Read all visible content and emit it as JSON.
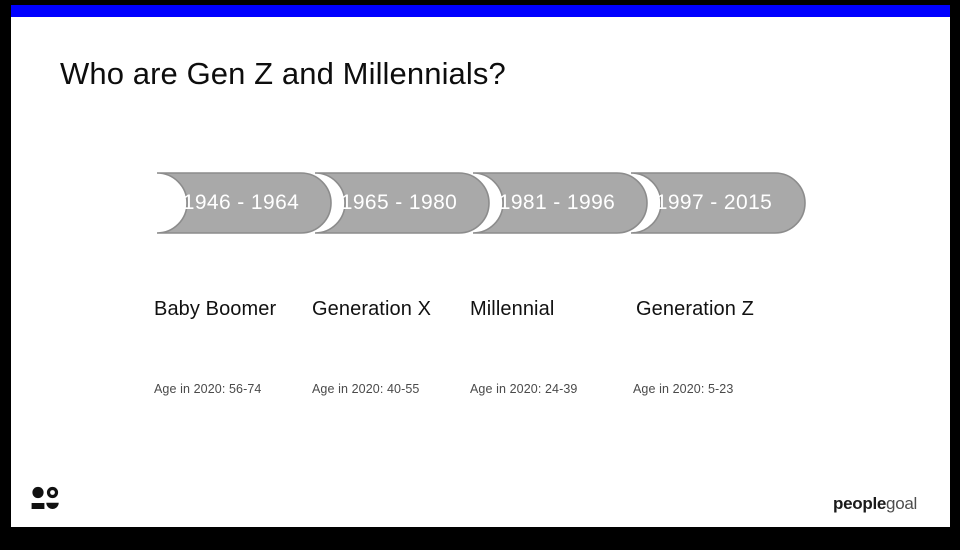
{
  "slide": {
    "title": "Who are Gen Z and Millennials?",
    "accent_color": "#0000ff",
    "segment_color": "#a9a9a9",
    "frame_color": "#000000",
    "background_color": "#ffffff"
  },
  "timeline": {
    "segments": [
      {
        "range": "1946 - 1964",
        "generation": "Baby Boomer",
        "age": "Age in 2020: 56-74"
      },
      {
        "range": "1965 - 1980",
        "generation": "Generation X",
        "age": "Age in 2020: 40-55"
      },
      {
        "range": "1981 - 1996",
        "generation": "Millennial",
        "age": "Age in 2020: 24-39"
      },
      {
        "range": "1997 - 2015",
        "generation": "Generation Z",
        "age": "Age in 2020: 5-23"
      }
    ]
  },
  "footer": {
    "mark_icon": "people-group-icon",
    "brand_bold": "people",
    "brand_light": "goal"
  }
}
